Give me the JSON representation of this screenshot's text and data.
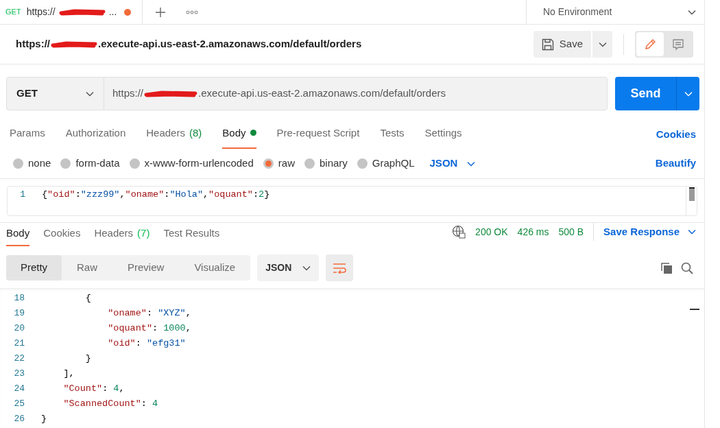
{
  "tab": {
    "method": "GET",
    "url_start": "https://",
    "url_end": "...",
    "unsaved": true
  },
  "environment": "No Environment",
  "request_title": {
    "start": "https://",
    "end": ".execute-api.us-east-2.amazonaws.com/default/orders"
  },
  "save_button": "Save",
  "mode_toggle": [
    {
      "kind": "edit",
      "selected": true
    },
    {
      "kind": "comment",
      "selected": false
    }
  ],
  "request": {
    "method": "GET",
    "url_start": "https://",
    "url_end": ".execute-api.us-east-2.amazonaws.com/default/orders",
    "send": "Send"
  },
  "request_tabs": [
    {
      "label": "Params",
      "selected": false
    },
    {
      "label": "Authorization",
      "selected": false
    },
    {
      "label": "Headers",
      "count": "(8)",
      "selected": false
    },
    {
      "label": "Body",
      "selected": true,
      "dot": true
    },
    {
      "label": "Pre-request Script",
      "selected": false
    },
    {
      "label": "Tests",
      "selected": false
    },
    {
      "label": "Settings",
      "selected": false
    }
  ],
  "cookies_link": "Cookies",
  "body_types": [
    {
      "label": "none",
      "selected": false
    },
    {
      "label": "form-data",
      "selected": false
    },
    {
      "label": "x-www-form-urlencoded",
      "selected": false
    },
    {
      "label": "raw",
      "selected": true
    },
    {
      "label": "binary",
      "selected": false
    },
    {
      "label": "GraphQL",
      "selected": false
    }
  ],
  "language": "JSON",
  "beautify": "Beautify",
  "request_body": [
    {
      "number": "1",
      "tokens": [
        {
          "kind": "punct",
          "text": "{"
        },
        {
          "kind": "key",
          "text": "\"oid\""
        },
        {
          "kind": "punct",
          "text": ":"
        },
        {
          "kind": "string",
          "text": "\"zzz99\""
        },
        {
          "kind": "punct",
          "text": ","
        },
        {
          "kind": "key",
          "text": "\"oname\""
        },
        {
          "kind": "punct",
          "text": ":"
        },
        {
          "kind": "string",
          "text": "\"Hola\""
        },
        {
          "kind": "punct",
          "text": ","
        },
        {
          "kind": "key",
          "text": "\"oquant\""
        },
        {
          "kind": "punct",
          "text": ":"
        },
        {
          "kind": "number",
          "text": "2"
        },
        {
          "kind": "punct",
          "text": "}"
        }
      ]
    }
  ],
  "response_tabs": [
    {
      "label": "Body",
      "selected": true
    },
    {
      "label": "Cookies",
      "selected": false
    },
    {
      "label": "Headers",
      "count": "(7)",
      "selected": false
    },
    {
      "label": "Test Results",
      "selected": false
    }
  ],
  "status": {
    "code": "200 OK",
    "time": "426 ms",
    "size": "500 B"
  },
  "save_response": "Save Response",
  "view_modes": [
    {
      "label": "Pretty",
      "selected": true
    },
    {
      "label": "Raw",
      "selected": false
    },
    {
      "label": "Preview",
      "selected": false
    },
    {
      "label": "Visualize",
      "selected": false
    }
  ],
  "response_language": "JSON",
  "response_body": [
    {
      "number": "18",
      "tokens": [
        {
          "kind": "punct",
          "text": "        {"
        }
      ]
    },
    {
      "number": "19",
      "tokens": [
        {
          "kind": "key",
          "text": "            \"oname\""
        },
        {
          "kind": "punct",
          "text": ": "
        },
        {
          "kind": "string",
          "text": "\"XYZ\""
        },
        {
          "kind": "punct",
          "text": ","
        }
      ]
    },
    {
      "number": "20",
      "tokens": [
        {
          "kind": "key",
          "text": "            \"oquant\""
        },
        {
          "kind": "punct",
          "text": ": "
        },
        {
          "kind": "number",
          "text": "1000"
        },
        {
          "kind": "punct",
          "text": ","
        }
      ]
    },
    {
      "number": "21",
      "tokens": [
        {
          "kind": "key",
          "text": "            \"oid\""
        },
        {
          "kind": "punct",
          "text": ": "
        },
        {
          "kind": "string",
          "text": "\"efg31\""
        }
      ]
    },
    {
      "number": "22",
      "tokens": [
        {
          "kind": "punct",
          "text": "        }"
        }
      ]
    },
    {
      "number": "23",
      "tokens": [
        {
          "kind": "punct",
          "text": "    ],"
        }
      ]
    },
    {
      "number": "24",
      "tokens": [
        {
          "kind": "key",
          "text": "    \"Count\""
        },
        {
          "kind": "punct",
          "text": ": "
        },
        {
          "kind": "number",
          "text": "4"
        },
        {
          "kind": "punct",
          "text": ","
        }
      ]
    },
    {
      "number": "25",
      "tokens": [
        {
          "kind": "key",
          "text": "    \"ScannedCount\""
        },
        {
          "kind": "punct",
          "text": ": "
        },
        {
          "kind": "number",
          "text": "4"
        }
      ]
    },
    {
      "number": "26",
      "tokens": [
        {
          "kind": "punct",
          "text": "}"
        }
      ]
    }
  ]
}
